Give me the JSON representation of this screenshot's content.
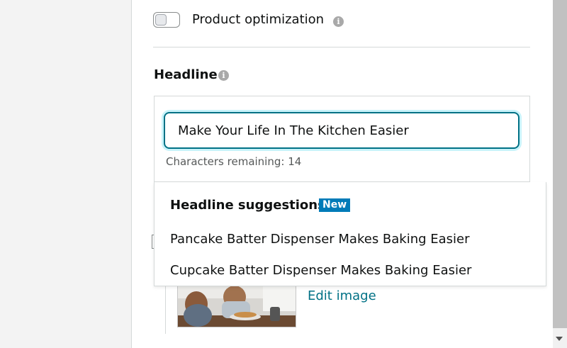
{
  "product_optimization": {
    "label": "Product optimization",
    "enabled": false
  },
  "headline": {
    "title": "Headline",
    "value": "Make Your Life In The Kitchen Easier",
    "chars_remaining": "Characters remaining: 14"
  },
  "suggestions": {
    "title": "Headline suggestions",
    "badge": "New",
    "items": [
      "Pancake Batter Dispenser Makes Baking Easier",
      "Cupcake Batter Dispenser Makes Baking Easier"
    ]
  },
  "image": {
    "edit_label": "Edit image"
  },
  "colors": {
    "accent": "#007185",
    "badge": "#007bb8",
    "focus_ring": "#c8f3fa"
  },
  "icons": [
    "info-icon",
    "scroll-down-arrow-icon"
  ]
}
